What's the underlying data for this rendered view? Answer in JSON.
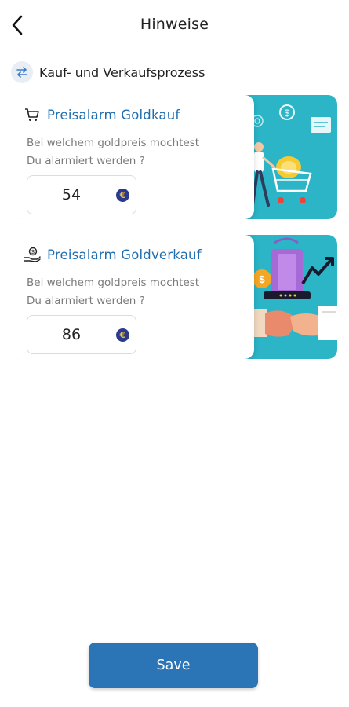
{
  "header": {
    "title": "Hinweise"
  },
  "section": {
    "title": "Kauf- und Verkaufsprozess"
  },
  "cards": [
    {
      "title": "Preisalarm Goldkauf",
      "question_line1": "Bei welchem goldpreis mochtest",
      "question_line2": "Du alarmiert werden ?",
      "value": "54",
      "currency_symbol": "€",
      "icon": "cart-icon",
      "illustration": "shopping-cart-illustration"
    },
    {
      "title": "Preisalarm Goldverkauf",
      "question_line1": "Bei welchem goldpreis mochtest",
      "question_line2": "Du alarmiert werden ?",
      "value": "86",
      "currency_symbol": "€",
      "icon": "hand-money-icon",
      "illustration": "handshake-illustration"
    }
  ],
  "footer": {
    "save_label": "Save"
  },
  "colors": {
    "primary": "#2b74b5",
    "card_title": "#1f6fb0",
    "card_art_bg": "#2bb5c6",
    "euro_coin": "#2b3a8c"
  }
}
